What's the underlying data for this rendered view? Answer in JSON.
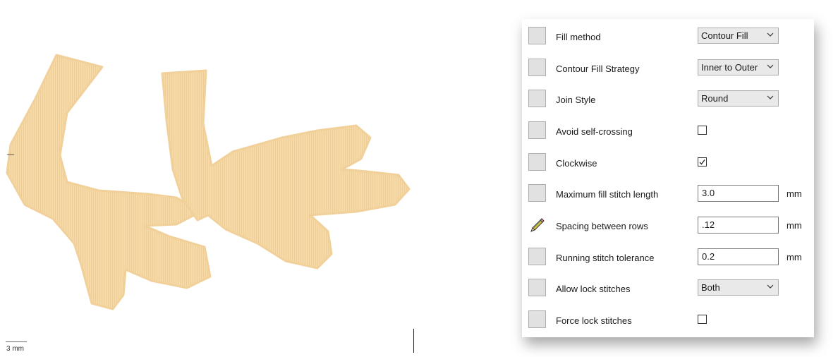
{
  "canvas": {
    "scale_label": "3 mm",
    "fill_color": "#f5d9a6",
    "outline_color": "#ecc88a"
  },
  "params": {
    "fill_method": {
      "label": "Fill method",
      "value": "Contour Fill"
    },
    "contour_fill_strategy": {
      "label": "Contour Fill Strategy",
      "value": "Inner to Outer"
    },
    "join_style": {
      "label": "Join Style",
      "value": "Round"
    },
    "avoid_self_crossing": {
      "label": "Avoid self-crossing",
      "checked": false
    },
    "clockwise": {
      "label": "Clockwise",
      "checked": true
    },
    "max_fill_stitch_length": {
      "label": "Maximum fill stitch length",
      "value": "3.0",
      "unit": "mm"
    },
    "spacing_between_rows": {
      "label": "Spacing between rows",
      "value": ".12",
      "unit": "mm",
      "icon": "pencil-icon"
    },
    "running_stitch_tolerance": {
      "label": "Running stitch tolerance",
      "value": "0.2",
      "unit": "mm"
    },
    "allow_lock_stitches": {
      "label": "Allow lock stitches",
      "value": "Both"
    },
    "force_lock_stitches": {
      "label": "Force lock stitches",
      "checked": false
    }
  }
}
